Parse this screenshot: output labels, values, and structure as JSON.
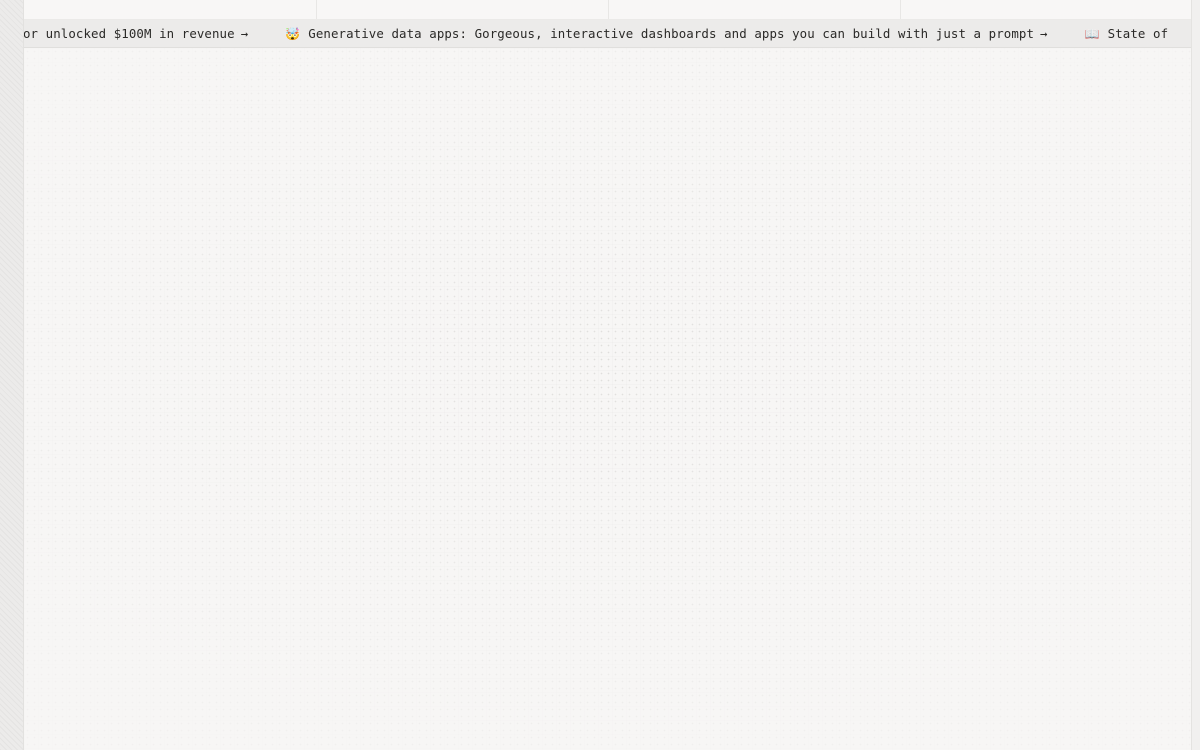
{
  "ticker": {
    "items": [
      {
        "emoji": "",
        "text": "or unlocked $100M in revenue",
        "arrow": "→"
      },
      {
        "emoji": "🤯",
        "text": "Generative data apps: Gorgeous, interactive dashboards and apps you can build with just a prompt",
        "arrow": "→"
      },
      {
        "emoji": "📖",
        "text": "State of",
        "arrow": ""
      }
    ]
  }
}
